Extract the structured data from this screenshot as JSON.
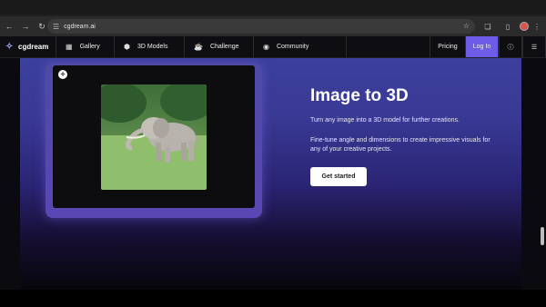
{
  "browser": {
    "url": "cgdream.ai",
    "icons": [
      "back-icon",
      "forward-icon",
      "reload-icon",
      "tune-icon",
      "star-icon",
      "extensions-icon",
      "sidepanel-icon",
      "profile-avatar",
      "kebab-menu-icon"
    ]
  },
  "nav": {
    "brand": "cgdream",
    "items": [
      {
        "label": "Gallery",
        "icon": "grid-icon"
      },
      {
        "label": "3D Models",
        "icon": "cube-icon"
      },
      {
        "label": "Challenge",
        "icon": "trophy-icon"
      },
      {
        "label": "Community",
        "icon": "discord-icon"
      }
    ],
    "pricing": "Pricing",
    "login": "Log In",
    "accent": "#6c5ce7"
  },
  "hero": {
    "title": "Image to 3D",
    "line1": "Turn any image into a 3D model for further creations.",
    "line2": "Fine-tune angle and dimensions to create impressive visuals for any of your creative projects.",
    "cta": "Get started"
  }
}
